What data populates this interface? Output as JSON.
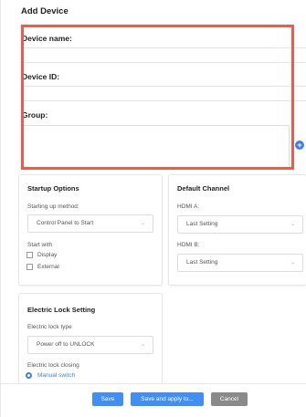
{
  "dialog": {
    "title": "Add Device",
    "device_name_label": "Device name:",
    "device_id_label": "Device ID:",
    "group_label": "Group:"
  },
  "startup": {
    "title": "Startup Options",
    "method_label": "Starting up method:",
    "method_value": "Control Panel to Start",
    "start_with_label": "Start with",
    "options": [
      "Display",
      "External"
    ]
  },
  "channel": {
    "title": "Default Channel",
    "hdmi_a_label": "HDMI A:",
    "hdmi_a_value": "Last Setting",
    "hdmi_b_label": "HDMI B:",
    "hdmi_b_value": "Last Setting"
  },
  "lock": {
    "title": "Electric Lock Setting",
    "type_label": "Electric lock type",
    "type_value": "Power off to UNLOCK",
    "closing_label": "Electric lock closing",
    "closing_value": "Manual switch"
  },
  "buttons": {
    "save": "Save",
    "apply": "Save and apply to...",
    "cancel": "Cancel"
  },
  "icons": {
    "add_group": "plus-circle-icon",
    "dropdown": "chevron-down-icon"
  },
  "colors": {
    "accent": "#3f8ff5",
    "highlight": "#ef5a4f",
    "cancel": "#8a8a8a"
  }
}
